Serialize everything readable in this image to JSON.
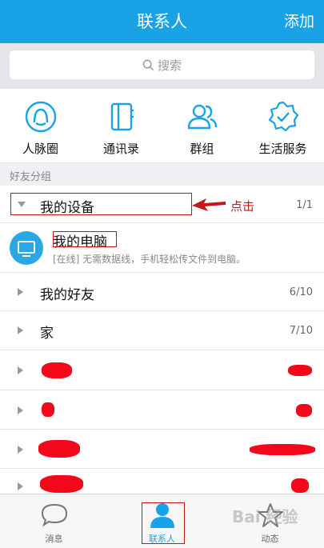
{
  "header": {
    "title": "联系人",
    "add_label": "添加"
  },
  "search": {
    "placeholder": "搜索"
  },
  "shortcuts": [
    {
      "label": "人脉圈",
      "icon": "face-circle-icon"
    },
    {
      "label": "通讯录",
      "icon": "address-book-icon"
    },
    {
      "label": "群组",
      "icon": "group-icon"
    },
    {
      "label": "生活服务",
      "icon": "badge-check-icon"
    }
  ],
  "friends_group_header": "好友分组",
  "groups": [
    {
      "name": "我的设备",
      "count": "1/1",
      "expanded": true
    },
    {
      "name": "我的好友",
      "count": "6/10",
      "expanded": false
    },
    {
      "name": "家",
      "count": "7/10",
      "expanded": false
    }
  ],
  "device": {
    "name": "我的电脑",
    "desc": "[在线] 无需数据线，手机轻松传文件到电脑。"
  },
  "annotation": {
    "text": "点击"
  },
  "tabs": [
    {
      "label": "消息",
      "icon": "chat-bubble-icon"
    },
    {
      "label": "联系人",
      "icon": "person-icon",
      "active": true
    },
    {
      "label": "动态",
      "icon": "star-icon"
    }
  ],
  "watermark": "Bai 经验",
  "colors": {
    "accent": "#1aa2e6",
    "annotation_red": "#c31818"
  }
}
